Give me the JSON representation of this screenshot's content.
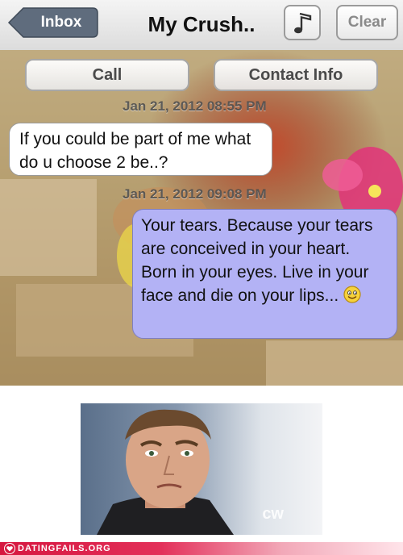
{
  "navbar": {
    "back_label": "Inbox",
    "title": "My Crush..",
    "music_icon": "music-note-icon",
    "clear_label": "Clear"
  },
  "actions": {
    "call_label": "Call",
    "contact_label": "Contact Info"
  },
  "messages": [
    {
      "timestamp": "Jan 21, 2012 08:55 PM",
      "direction": "incoming",
      "text": "If you could be part of me what do u choose 2 be..?"
    },
    {
      "timestamp": "Jan 21, 2012 09:08 PM",
      "direction": "outgoing",
      "text": "Your tears. Because your tears are conceived in your heart. Born in your eyes. Live in your face and die on your lips...",
      "emoji": "smiley-emoji"
    }
  ],
  "photo": {
    "watermark": "cw"
  },
  "footer": {
    "brand": "DATINGFAILS.ORG"
  },
  "colors": {
    "inbox_button": "#5f6c7d",
    "outgoing_bubble": "#b3b2f5",
    "incoming_bubble": "#ffffff",
    "footer_accent": "#d6173f"
  }
}
